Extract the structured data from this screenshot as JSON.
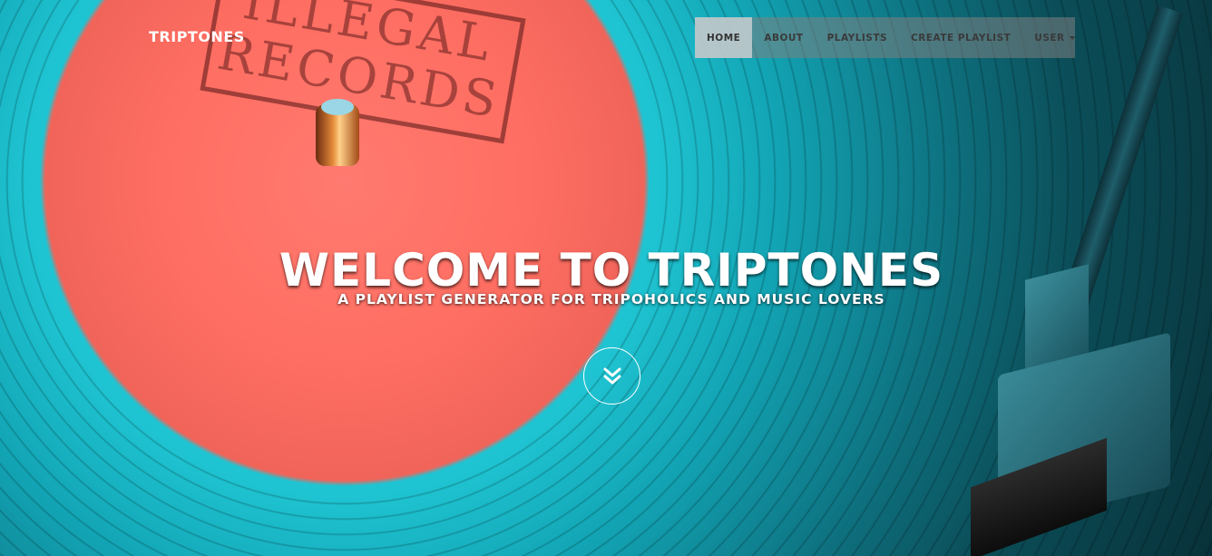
{
  "brand": {
    "name": "TRIPTONES"
  },
  "nav": {
    "items": [
      {
        "label": "HOME",
        "active": true
      },
      {
        "label": "ABOUT",
        "active": false
      },
      {
        "label": "PLAYLISTS",
        "active": false
      },
      {
        "label": "CREATE PLAYLIST",
        "active": false
      },
      {
        "label": "USER",
        "active": false,
        "dropdown": true
      }
    ]
  },
  "intro": {
    "heading": "WELCOME TO TRIPTONES",
    "subheading": "A PLAYLIST GENERATOR FOR TRIPOHOLICS AND MUSIC LOVERS",
    "scroll_icon": "double-chevron-down-icon"
  },
  "colors": {
    "text": "#ffffff",
    "nav_background": "#808080",
    "nav_active": "#cdd2d4",
    "record_label": "#ff6e62",
    "vinyl_teal": "#12a4b4"
  }
}
